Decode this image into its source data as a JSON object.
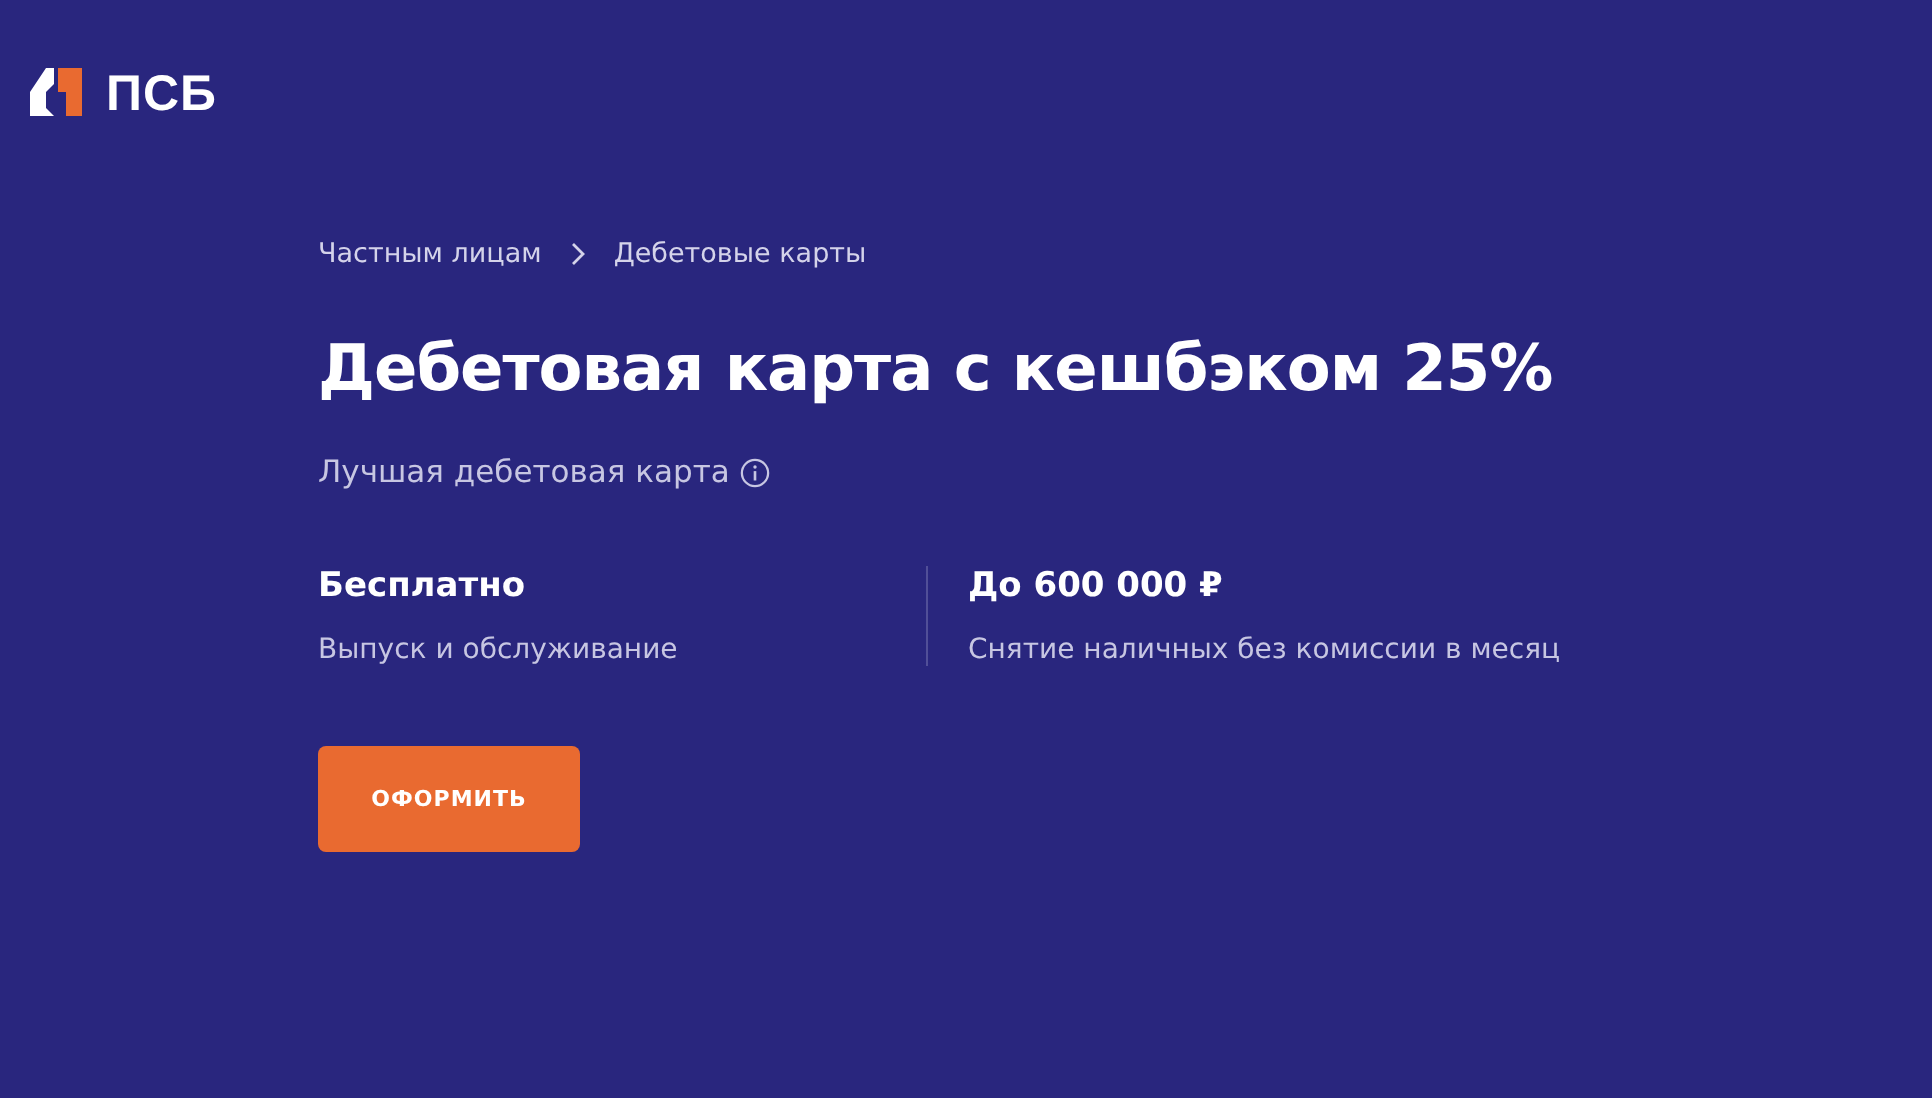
{
  "logo": {
    "text": "ПСБ"
  },
  "breadcrumbs": [
    "Частным лицам",
    "Дебетовые карты"
  ],
  "title": "Дебетовая карта с кешбэком 25%",
  "subtitle": "Лучшая дебетовая карта",
  "features": [
    {
      "value": "Бесплатно",
      "caption": "Выпуск и обслуживание"
    },
    {
      "value": "До 600 000 ₽",
      "caption": "Снятие наличных без комиссии в месяц"
    }
  ],
  "button": "ОФОРМИТЬ"
}
